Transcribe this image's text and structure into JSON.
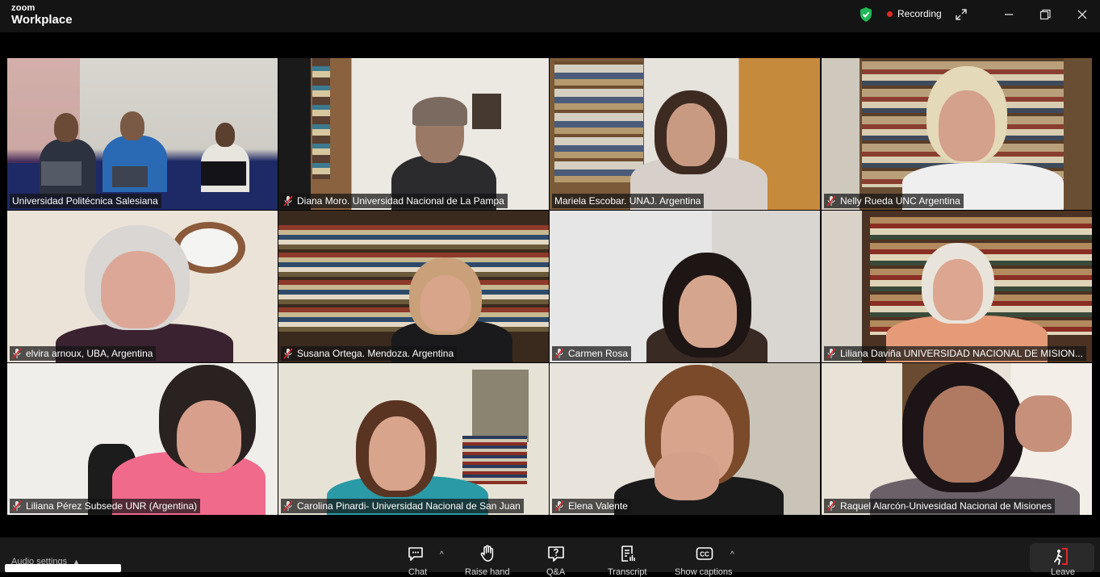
{
  "app": {
    "brand_small": "zoom",
    "brand_large": "Workplace"
  },
  "status": {
    "recording_label": "Recording"
  },
  "participants": [
    {
      "name": "Universidad Politécnica Salesiana",
      "muted": false,
      "active": false
    },
    {
      "name": "Diana Moro. Universidad Nacional de La Pampa",
      "muted": true,
      "active": false
    },
    {
      "name": "Mariela Escobar. UNAJ. Argentina",
      "muted": false,
      "active": true
    },
    {
      "name": "Nelly Rueda UNC Argentina",
      "muted": true,
      "active": false
    },
    {
      "name": "elvira arnoux, UBA, Argentina",
      "muted": true,
      "active": false
    },
    {
      "name": "Susana Ortega. Mendoza. Argentina",
      "muted": true,
      "active": false
    },
    {
      "name": "Carmen Rosa",
      "muted": true,
      "active": false
    },
    {
      "name": "Liliana Daviña UNIVERSIDAD NACIONAL DE MISION...",
      "muted": true,
      "active": false
    },
    {
      "name": "Liliana Pérez Subsede UNR (Argentina)",
      "muted": true,
      "active": false
    },
    {
      "name": "Carolina Pinardi- Universidad Nacional de San Juan",
      "muted": true,
      "active": false
    },
    {
      "name": "Elena Valente",
      "muted": true,
      "active": false
    },
    {
      "name": "Raquel Alarcón-Univesidad Nacional de Misiones",
      "muted": true,
      "active": false
    }
  ],
  "toolbar": {
    "audio_settings": "Audio settings",
    "chat": "Chat",
    "raise_hand": "Raise hand",
    "qa": "Q&A",
    "transcript": "Transcript",
    "show_captions": "Show captions",
    "leave": "Leave"
  },
  "colors": {
    "active_speaker": "#27c86b",
    "recording_dot": "#e02828",
    "leave_icon": "#e02828"
  }
}
